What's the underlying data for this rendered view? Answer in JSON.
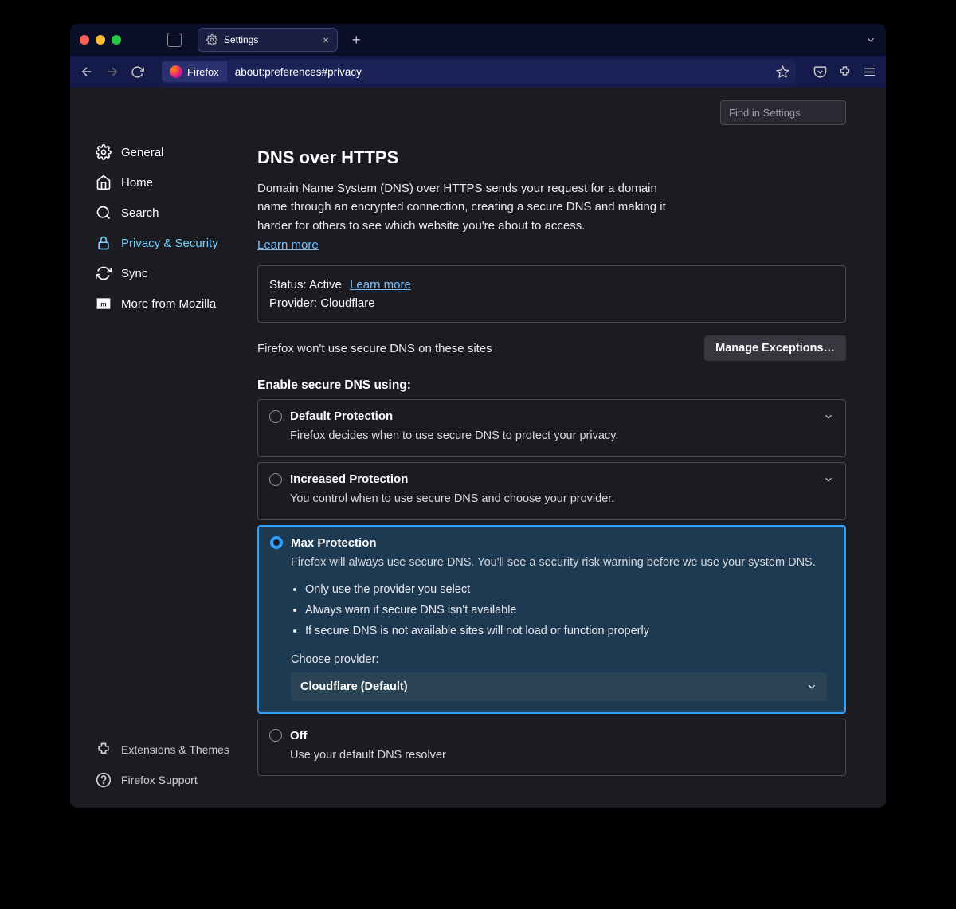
{
  "tab": {
    "title": "Settings"
  },
  "url": {
    "badge": "Firefox",
    "text": "about:preferences#privacy"
  },
  "sidebar": {
    "items": [
      {
        "label": "General"
      },
      {
        "label": "Home"
      },
      {
        "label": "Search"
      },
      {
        "label": "Privacy & Security"
      },
      {
        "label": "Sync"
      },
      {
        "label": "More from Mozilla"
      }
    ],
    "bottom": [
      {
        "label": "Extensions & Themes"
      },
      {
        "label": "Firefox Support"
      }
    ]
  },
  "search": {
    "placeholder": "Find in Settings"
  },
  "page": {
    "title": "DNS over HTTPS",
    "desc": "Domain Name System (DNS) over HTTPS sends your request for a domain name through an encrypted connection, creating a secure DNS and making it harder for others to see which website you're about to access.",
    "learn": "Learn more",
    "status_prefix": "Status: ",
    "status_value": "Active",
    "status_learn": "Learn more",
    "provider_prefix": "Provider: ",
    "provider_value": "Cloudflare",
    "exceptions_text": "Firefox won't use secure DNS on these sites",
    "manage_btn": "Manage Exceptions…",
    "enable_head": "Enable secure DNS using:",
    "options": [
      {
        "title": "Default Protection",
        "desc": "Firefox decides when to use secure DNS to protect your privacy."
      },
      {
        "title": "Increased Protection",
        "desc": "You control when to use secure DNS and choose your provider."
      },
      {
        "title": "Max Protection",
        "desc": "Firefox will always use secure DNS. You'll see a security risk warning before we use your system DNS.",
        "bullets": [
          "Only use the provider you select",
          "Always warn if secure DNS isn't available",
          "If secure DNS is not available sites will not load or function properly"
        ],
        "choose_label": "Choose provider:",
        "provider_select": "Cloudflare (Default)"
      },
      {
        "title": "Off",
        "desc": "Use your default DNS resolver"
      }
    ]
  }
}
